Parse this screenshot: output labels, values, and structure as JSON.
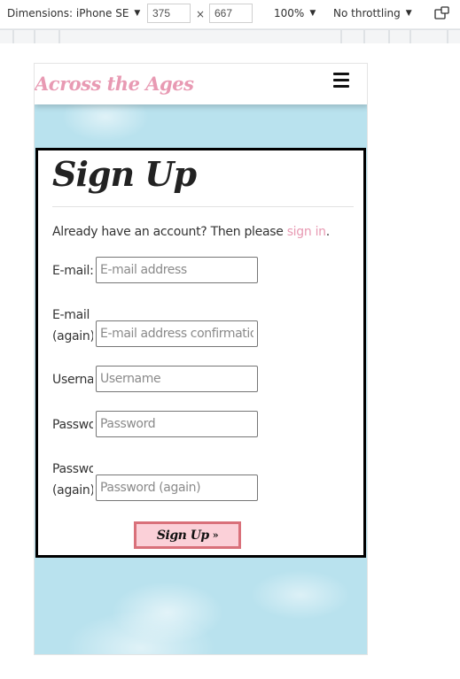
{
  "devtools": {
    "dimensions_label": "Dimensions: iPhone SE",
    "width": "375",
    "height": "667",
    "times": "×",
    "zoom": "100%",
    "throttling": "No throttling"
  },
  "site": {
    "brand": "Across the Ages",
    "page_title": "Sign Up",
    "intro_text": "Already have an account? Then please ",
    "intro_link": "sign in",
    "intro_end": ".",
    "fields": [
      {
        "label": "E-mail:",
        "placeholder": "E-mail address"
      },
      {
        "label": "E-mail (again):",
        "placeholder": "E-mail address confirmation"
      },
      {
        "label": "Username:",
        "placeholder": "Username"
      },
      {
        "label": "Password:",
        "placeholder": "Password"
      },
      {
        "label": "Password (again):",
        "placeholder": "Password (again)"
      }
    ],
    "submit_label": "Sign Up",
    "submit_chevron": "»"
  },
  "colors": {
    "brand": "#e89ab3",
    "button_bg": "#fbd0d8",
    "button_border": "#d9707a",
    "sky": "#b9e2ee"
  }
}
